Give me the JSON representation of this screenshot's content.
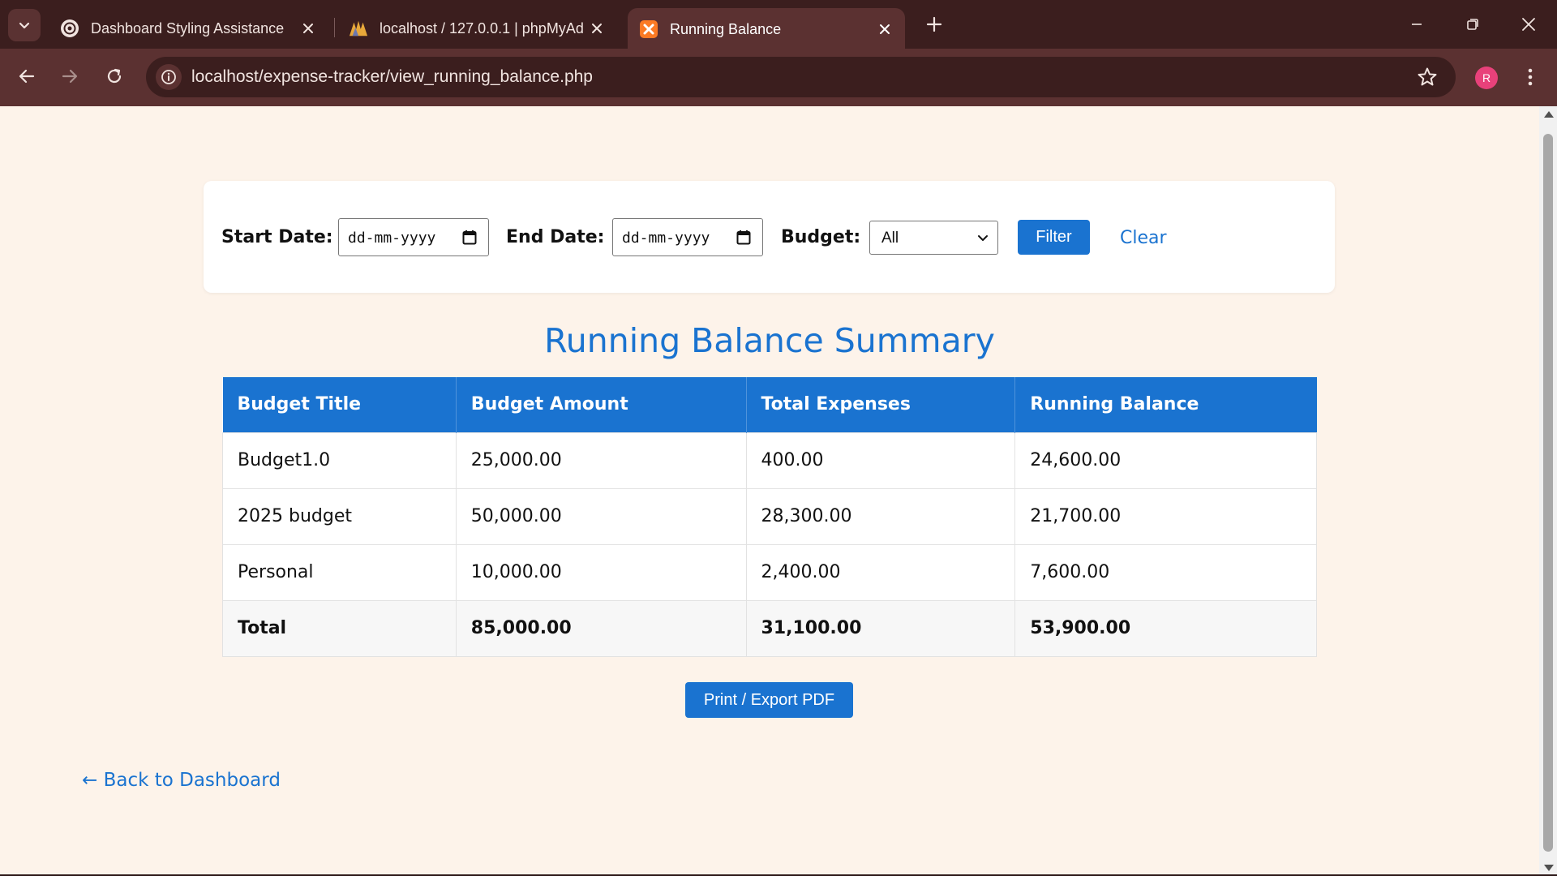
{
  "browser": {
    "tabs": [
      {
        "title": "Dashboard Styling Assistance",
        "icon": "openai-icon",
        "active": false
      },
      {
        "title": "localhost / 127.0.0.1 | phpMyAd",
        "icon": "phpmyadmin-icon",
        "active": false
      },
      {
        "title": "Running Balance",
        "icon": "xampp-icon",
        "active": true
      }
    ],
    "url": "localhost/expense-tracker/view_running_balance.php",
    "profile_initial": "R"
  },
  "filter": {
    "start_label": "Start Date:",
    "start_placeholder": "dd-mm-yyyy",
    "end_label": "End Date:",
    "end_placeholder": "dd-mm-yyyy",
    "budget_label": "Budget:",
    "budget_selected": "All",
    "filter_button": "Filter",
    "clear_link": "Clear"
  },
  "summary": {
    "title": "Running Balance Summary",
    "columns": [
      "Budget Title",
      "Budget Amount",
      "Total Expenses",
      "Running Balance"
    ],
    "rows": [
      [
        "Budget1.0",
        "25,000.00",
        "400.00",
        "24,600.00"
      ],
      [
        "2025 budget",
        "50,000.00",
        "28,300.00",
        "21,700.00"
      ],
      [
        "Personal",
        "10,000.00",
        "2,400.00",
        "7,600.00"
      ]
    ],
    "total": [
      "Total",
      "85,000.00",
      "31,100.00",
      "53,900.00"
    ]
  },
  "actions": {
    "print_button": "Print / Export PDF",
    "back_link": "← Back to Dashboard"
  },
  "colors": {
    "accent": "#1a73d0",
    "page_bg": "#fdf3ea",
    "chrome_dark": "#3b1e1e",
    "chrome_mid": "#5b3131",
    "avatar": "#e8417a"
  }
}
